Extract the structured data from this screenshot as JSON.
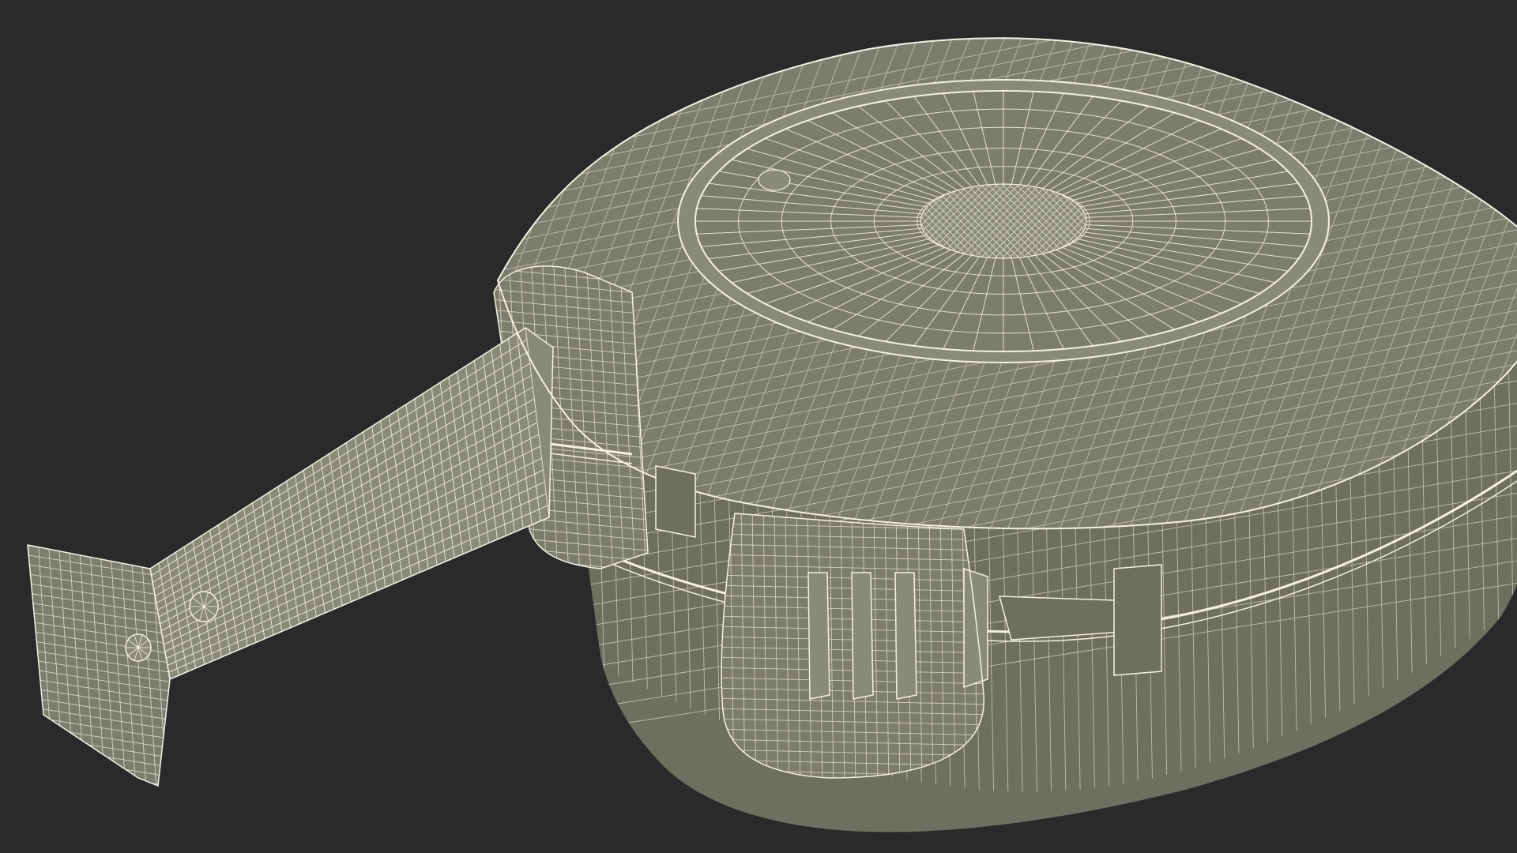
{
  "colors": {
    "background": "#2a2a2a",
    "surface": "#7d7d6f",
    "surface_light": "#8a8a7b",
    "surface_dark": "#6e6e61",
    "wire": "#f3f1e4"
  },
  "subject": {
    "icon": "tape-measure-wireframe-icon"
  }
}
